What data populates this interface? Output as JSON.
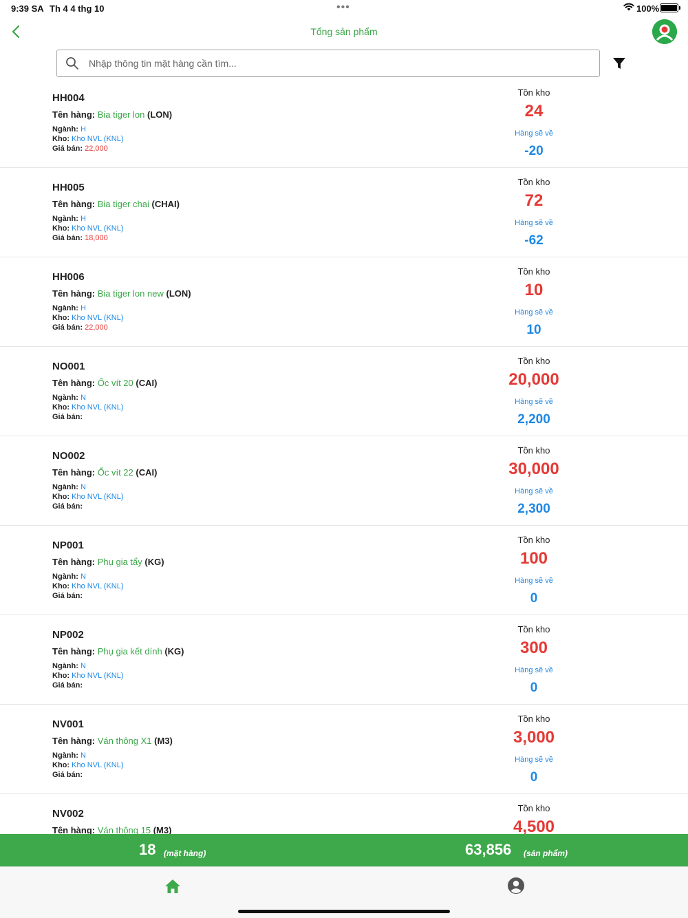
{
  "status_bar": {
    "time": "9:39 SA",
    "date": "Th 4 4 thg 10",
    "dots": "•••",
    "battery": "100%"
  },
  "header": {
    "title": "Tổng sản phẩm",
    "back_icon": "chevron-left-icon",
    "avatar_icon": "user-avatar-icon"
  },
  "search": {
    "placeholder": "Nhập thông tin mặt hàng cần tìm...",
    "value": ""
  },
  "labels": {
    "ten_hang": "Tên hàng:",
    "nganh": "Ngành:",
    "kho": "Kho:",
    "gia_ban": "Giá bán:",
    "ton_kho": "Tồn kho",
    "hang_se_ve": "Hàng sẽ về"
  },
  "items": [
    {
      "code": "HH004",
      "name": "Bia tiger lon",
      "unit": "(LON)",
      "nganh": "H",
      "kho": "Kho NVL (KNL)",
      "gia_ban": "22,000",
      "ton_kho": "24",
      "hang_se_ve": "-20"
    },
    {
      "code": "HH005",
      "name": "Bia tiger chai",
      "unit": "(CHAI)",
      "nganh": "H",
      "kho": "Kho NVL (KNL)",
      "gia_ban": "18,000",
      "ton_kho": "72",
      "hang_se_ve": "-62"
    },
    {
      "code": "HH006",
      "name": "Bia tiger lon new",
      "unit": "(LON)",
      "nganh": "H",
      "kho": "Kho NVL (KNL)",
      "gia_ban": "22,000",
      "ton_kho": "10",
      "hang_se_ve": "10"
    },
    {
      "code": "NO001",
      "name": "Ốc vít 20",
      "unit": "(CAI)",
      "nganh": "N",
      "kho": "Kho NVL (KNL)",
      "gia_ban": "",
      "ton_kho": "20,000",
      "hang_se_ve": "2,200"
    },
    {
      "code": "NO002",
      "name": "Ốc vít 22",
      "unit": "(CAI)",
      "nganh": "N",
      "kho": "Kho NVL (KNL)",
      "gia_ban": "",
      "ton_kho": "30,000",
      "hang_se_ve": "2,300"
    },
    {
      "code": "NP001",
      "name": "Phụ gia tẩy",
      "unit": "(KG)",
      "nganh": "N",
      "kho": "Kho NVL (KNL)",
      "gia_ban": "",
      "ton_kho": "100",
      "hang_se_ve": "0"
    },
    {
      "code": "NP002",
      "name": "Phụ gia kết dính",
      "unit": "(KG)",
      "nganh": "N",
      "kho": "Kho NVL (KNL)",
      "gia_ban": "",
      "ton_kho": "300",
      "hang_se_ve": "0"
    },
    {
      "code": "NV001",
      "name": "Ván thông X1",
      "unit": "(M3)",
      "nganh": "N",
      "kho": "Kho NVL (KNL)",
      "gia_ban": "",
      "ton_kho": "3,000",
      "hang_se_ve": "0"
    },
    {
      "code": "NV002",
      "name": "Ván thông 15",
      "unit": "(M3)",
      "nganh": "",
      "kho": "",
      "gia_ban": "",
      "ton_kho": "4,500",
      "hang_se_ve": ""
    }
  ],
  "summary": {
    "item_count": "18",
    "item_count_unit": "(mặt hàng)",
    "total_products": "63,856",
    "total_products_unit": "(sản phẩm)"
  },
  "tab_bar": {
    "home_icon": "home-icon",
    "profile_icon": "account-circle-icon"
  },
  "colors": {
    "brand_green": "#3ea94a",
    "stock_red": "#e53935",
    "info_blue": "#1e88e5"
  }
}
